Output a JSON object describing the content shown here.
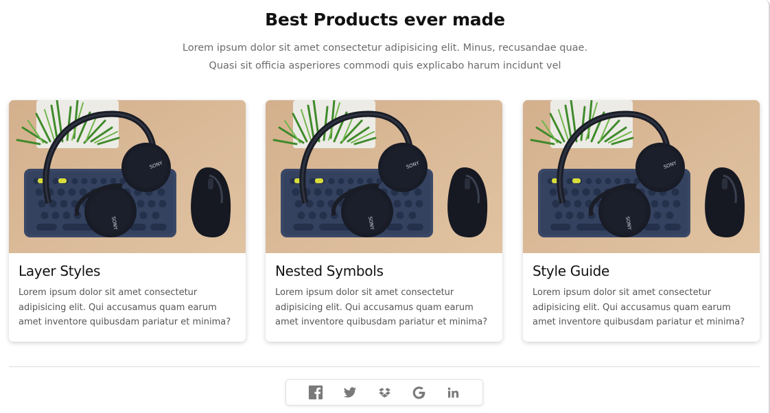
{
  "header": {
    "title": "Best Products ever made",
    "subtitle_line1": "Lorem ipsum dolor sit amet consectetur adipisicing elit. Minus, recusandae quae.",
    "subtitle_line2": "Quasi sit officia asperiores commodi quis explicabo harum incidunt vel"
  },
  "cards": [
    {
      "title": "Layer Styles",
      "text": "Lorem ipsum dolor sit amet consectetur adipisicing elit. Qui accusamus quam earum amet inventore quibusdam pariatur et minima?",
      "image": "headphones-keyboard-mouse-photo"
    },
    {
      "title": "Nested Symbols",
      "text": "Lorem ipsum dolor sit amet consectetur adipisicing elit. Qui accusamus quam earum amet inventore quibusdam pariatur et minima?",
      "image": "headphones-keyboard-mouse-photo"
    },
    {
      "title": "Style Guide",
      "text": "Lorem ipsum dolor sit amet consectetur adipisicing elit. Qui accusamus quam earum amet inventore quibusdam pariatur et minima?",
      "image": "headphones-keyboard-mouse-photo"
    }
  ],
  "social": {
    "icons": [
      "facebook-icon",
      "twitter-icon",
      "dropbox-icon",
      "google-icon",
      "linkedin-icon"
    ],
    "icon_color": "#7a7a7a"
  },
  "colors": {
    "title": "#111111",
    "subtitle": "#6b6b6b",
    "card_text": "#555555",
    "photo_background": "#d9b896"
  }
}
